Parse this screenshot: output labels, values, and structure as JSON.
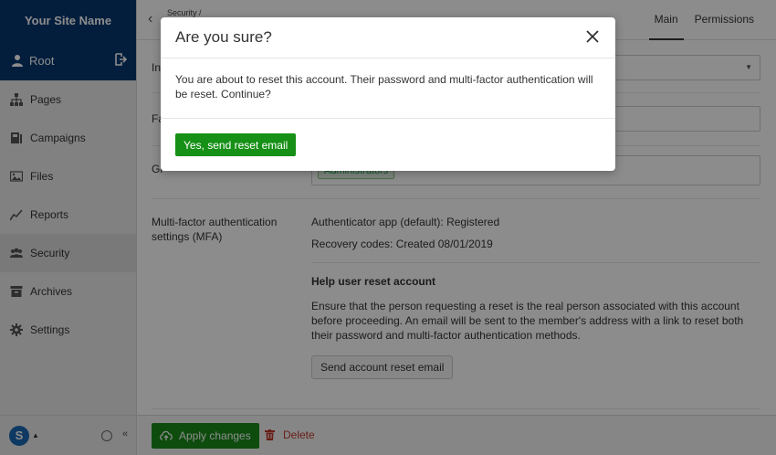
{
  "sidebar": {
    "site_name": "Your Site Name",
    "user": "Root",
    "items": [
      {
        "label": "Pages",
        "icon": "sitemap-icon"
      },
      {
        "label": "Campaigns",
        "icon": "campaigns-icon"
      },
      {
        "label": "Files",
        "icon": "image-icon"
      },
      {
        "label": "Reports",
        "icon": "chart-line-icon"
      },
      {
        "label": "Security",
        "icon": "users-icon",
        "active": true
      },
      {
        "label": "Archives",
        "icon": "archive-icon"
      },
      {
        "label": "Settings",
        "icon": "gear-icon"
      }
    ],
    "brand_glyph": "S",
    "collapse_glyph": "«"
  },
  "topbar": {
    "breadcrumb": "Security /",
    "tabs": [
      "Main",
      "Permissions"
    ]
  },
  "form": {
    "row1_label": "In",
    "row2_label": "Fa",
    "row3_label": "Gr",
    "group_tag": "Administrators"
  },
  "mfa": {
    "label": "Multi-factor authentication settings (MFA)",
    "authenticator": "Authenticator app (default): Registered",
    "recovery": "Recovery codes: Created 08/01/2019",
    "help_title": "Help user reset account",
    "help_text": "Ensure that the person requesting a reset is the real person associated with this account before proceeding. An email will be sent to the member's address with a link to reset both their password and multi-factor authentication methods.",
    "reset_button": "Send account reset email"
  },
  "footer": {
    "apply_label": "Apply changes",
    "delete_label": "Delete"
  },
  "modal": {
    "title": "Are you sure?",
    "body": "You are about to reset this account. Their password and multi-factor authentication will be reset. Continue?",
    "confirm_label": "Yes, send reset email"
  },
  "colors": {
    "sidebar_header": "#06386f",
    "primary_green": "#169016",
    "delete_red": "#c0392b"
  }
}
